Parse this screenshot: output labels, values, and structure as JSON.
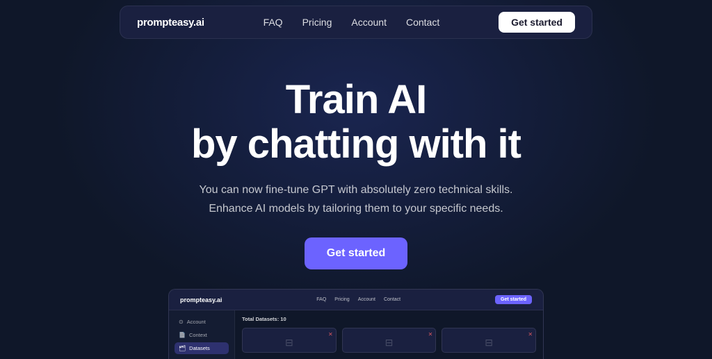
{
  "brand": {
    "name": "prompteasy.ai"
  },
  "nav": {
    "links": [
      {
        "label": "FAQ",
        "id": "faq"
      },
      {
        "label": "Pricing",
        "id": "pricing"
      },
      {
        "label": "Account",
        "id": "account"
      },
      {
        "label": "Contact",
        "id": "contact"
      }
    ],
    "cta_label": "Get started"
  },
  "hero": {
    "title_line1": "Train AI",
    "title_line2": "by chatting with it",
    "subtitle_line1": "You can now fine-tune GPT with absolutely zero technical skills.",
    "subtitle_line2": "Enhance AI models by tailoring them to your specific needs.",
    "cta_label": "Get started"
  },
  "preview": {
    "brand": "prompteasy.ai",
    "nav_links": [
      "FAQ",
      "Pricing",
      "Account",
      "Contact"
    ],
    "cta_label": "Get started",
    "sidebar_items": [
      {
        "label": "Account",
        "icon": "⊙",
        "active": false
      },
      {
        "label": "Context",
        "icon": "📄",
        "active": false
      },
      {
        "label": "Datasets",
        "icon": "🗂",
        "active": true
      }
    ],
    "main_title": "Total Datasets: 10"
  }
}
